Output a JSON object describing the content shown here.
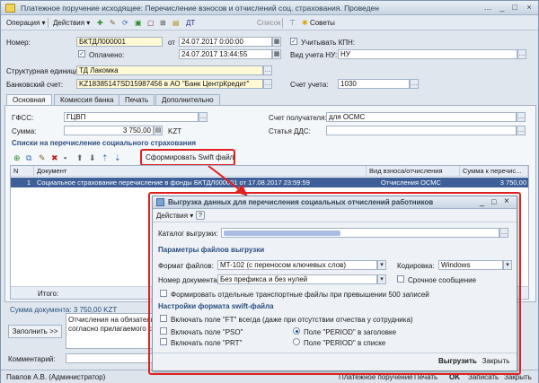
{
  "window": {
    "title": "Платежное поручение исходящее: Перечисление взносов и отчислений соц. страхования. Проведен"
  },
  "toolbar": {
    "operation": "Операция",
    "actions": "Действия",
    "list": "Список",
    "advice": "Советы"
  },
  "header": {
    "number_label": "Номер:",
    "number_value": "БКТДЛ000001",
    "from_label": "от",
    "date_value": "24.07.2017  0:00:00",
    "paid_checkbox_label": "Оплачено:",
    "paid_date": "24.07.2017  13:44:55",
    "kpn_label": "Учитывать КПН:",
    "vid_label": "Вид учета НУ:",
    "vid_value": "НУ",
    "struct_label": "Структурная единица:",
    "struct_value": "ТД Лакомка",
    "bank_label": "Банковский счет:",
    "bank_value": "KZ18385147SD15987456 в АО \"Банк ЦентрКредит\"",
    "account_label": "Счет учета:",
    "account_value": "1030"
  },
  "tabs": [
    "Основная",
    "Комиссия банка",
    "Печать",
    "Дополнительно"
  ],
  "main": {
    "gfss_label": "ГФСС:",
    "gfss_value": "ГЦВП",
    "recipient_label": "Счет получателя:",
    "recipient_value": "для ОСМС",
    "sum_label": "Сумма:",
    "sum_value": "3 750,00",
    "currency": "KZT",
    "dds_label": "Статья ДДС:",
    "section_title": "Списки на перечисление социального страхования",
    "swift_button": "Сформировать Swift файл",
    "columns": [
      "N",
      "Документ",
      "Вид взноса/отчисления",
      "Сумма к перечис..."
    ],
    "row": {
      "n": "1",
      "doc": "Социальное страхование перечисление в фонды БКТДЛ000001 от 17.08.2017 23:59:59",
      "kind": "Отчисления ОСМС",
      "sum": "3 750,00"
    },
    "total_label": "Итого:"
  },
  "bottom": {
    "doc_sum": "Сумма документа: 3 750,00 KZT",
    "fill_button": "Заполнить >>",
    "purpose_line1": "Отчисления на обязательно",
    "purpose_line2": "согласно прилагаемого спи",
    "comment_label": "Комментарий:",
    "user": "Павлов А.В. (Администратор)"
  },
  "status_actions": {
    "print_doc": "Платежное поручение",
    "print": "Печать",
    "ok": "OK",
    "save": "Записать",
    "close": "Закрыть"
  },
  "dialog": {
    "title": "Выгрузка данных для перечисления социальных отчислений работников",
    "actions": "Действия",
    "catalog_label": "Каталог выгрузки:",
    "params_title": "Параметры файлов выгрузки",
    "format_label": "Формат файлов:",
    "format_value": "MT-102 (с переносом ключевых слов)",
    "encoding_label": "Кодировка:",
    "encoding_value": "Windows",
    "docnum_label": "Номер документа:",
    "docnum_value": "Без префикса и без нулей",
    "urgent_label": "Срочное сообщение",
    "transport_label": "Формировать отдельные транспортные файлы при превышении 500 записей",
    "swift_settings_title": "Настройки формата swift-файла",
    "ft_label": "Включать поле \"FT\" всегда (даже при отсутствии отчества у сотрудника)",
    "pso_label": "Включать поле \"PSO\"",
    "prt_label": "Включать поле \"PRT\"",
    "period_header": "Поле \"PERIOD\" в заголовке",
    "period_list": "Поле \"PERIOD\" в списке",
    "upload_button": "Выгрузить",
    "close_button": "Закрыть"
  },
  "colors": {
    "accent_red": "#e02020",
    "selection": "#3f5f99",
    "section": "#2b4e7d"
  }
}
